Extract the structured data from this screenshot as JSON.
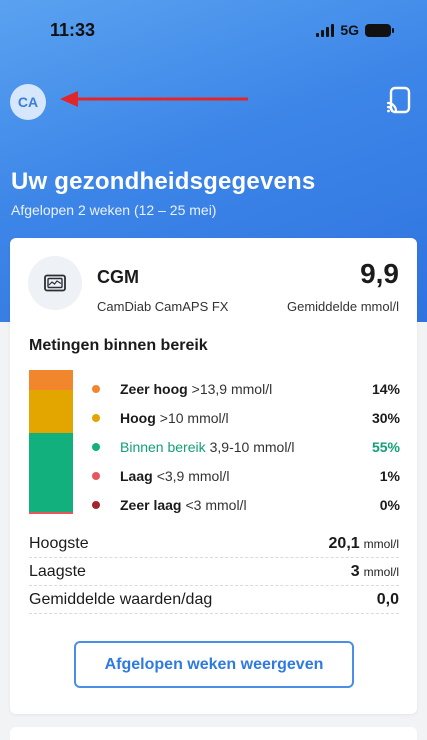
{
  "status_bar": {
    "time": "11:33",
    "network": "5G"
  },
  "header": {
    "avatar_initials": "CA",
    "title": "Uw gezondheidsgegevens",
    "subtitle": "Afgelopen 2 weken (12 – 25 mei)"
  },
  "cgm_card": {
    "name": "CGM",
    "device": "CamDiab CamAPS FX",
    "average_value": "9,9",
    "average_label": "Gemiddelde mmol/l",
    "section_title": "Metingen binnen bereik",
    "ranges": [
      {
        "label": "Zeer hoog",
        "range": ">13,9 mmol/l",
        "percent": "14%",
        "fraction": 0.14,
        "color": "#f2862c"
      },
      {
        "label": "Hoog",
        "range": ">10 mmol/l",
        "percent": "30%",
        "fraction": 0.3,
        "color": "#e3a500"
      },
      {
        "label": "Binnen bereik",
        "range": "3,9-10 mmol/l",
        "percent": "55%",
        "fraction": 0.55,
        "color": "#12b07c"
      },
      {
        "label": "Laag",
        "range": "<3,9 mmol/l",
        "percent": "1%",
        "fraction": 0.01,
        "color": "#e8565c"
      },
      {
        "label": "Zeer laag",
        "range": "<3 mmol/l",
        "percent": "0%",
        "fraction": 0.0,
        "color": "#a3232f"
      }
    ],
    "stats": [
      {
        "label": "Hoogste",
        "value": "20,1",
        "unit": "mmol/l"
      },
      {
        "label": "Laagste",
        "value": "3",
        "unit": "mmol/l"
      },
      {
        "label": "Gemiddelde waarden/dag",
        "value": "0,0",
        "unit": ""
      }
    ],
    "button_label": "Afgelopen weken weergeven"
  },
  "colors": {
    "accent": "#2f7ae0",
    "in_range_text": "#12a074",
    "annotation_arrow": "#e0262a"
  },
  "icons": [
    "avatar",
    "annotation-arrow",
    "cast-to-device-icon",
    "cgm-device-icon"
  ]
}
